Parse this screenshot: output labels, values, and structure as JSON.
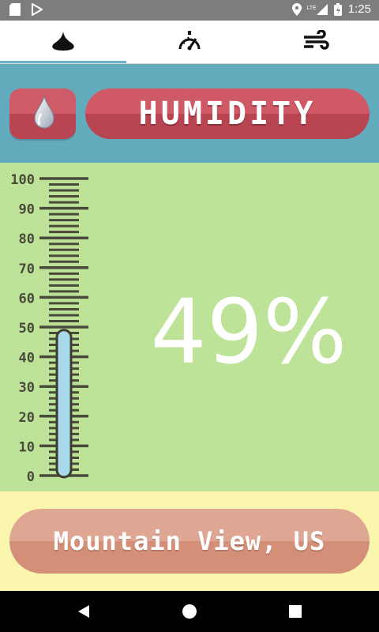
{
  "status_bar": {
    "time": "1:25",
    "network_label": "LTE",
    "icons": [
      "sd-card-icon",
      "play-store-icon",
      "location-icon",
      "signal-icon",
      "battery-icon"
    ]
  },
  "tabs": [
    {
      "name": "humidity",
      "icon": "droplet-icon",
      "selected": true
    },
    {
      "name": "pressure",
      "icon": "gauge-icon",
      "selected": false
    },
    {
      "name": "wind",
      "icon": "wind-icon",
      "selected": false
    }
  ],
  "header": {
    "title": "HUMIDITY",
    "icon": "droplet-icon"
  },
  "gauge": {
    "value": 49,
    "min": 0,
    "max": 100,
    "tick_labels": [
      "100",
      "90",
      "80",
      "70",
      "60",
      "50",
      "40",
      "30",
      "20",
      "10",
      "0"
    ]
  },
  "reading": {
    "text": "49%"
  },
  "location": {
    "label": "Mountain View, US"
  },
  "colors": {
    "status_bar": "#7d7d7d",
    "tab_indicator": "#6fb5c8",
    "header_bg": "#62abbd",
    "title_red": "#c44e5c",
    "main_bg": "#bde398",
    "mercury": "#a8d8ea",
    "footer_bg": "#fbf6ae",
    "location_btn": "#da9a86"
  }
}
